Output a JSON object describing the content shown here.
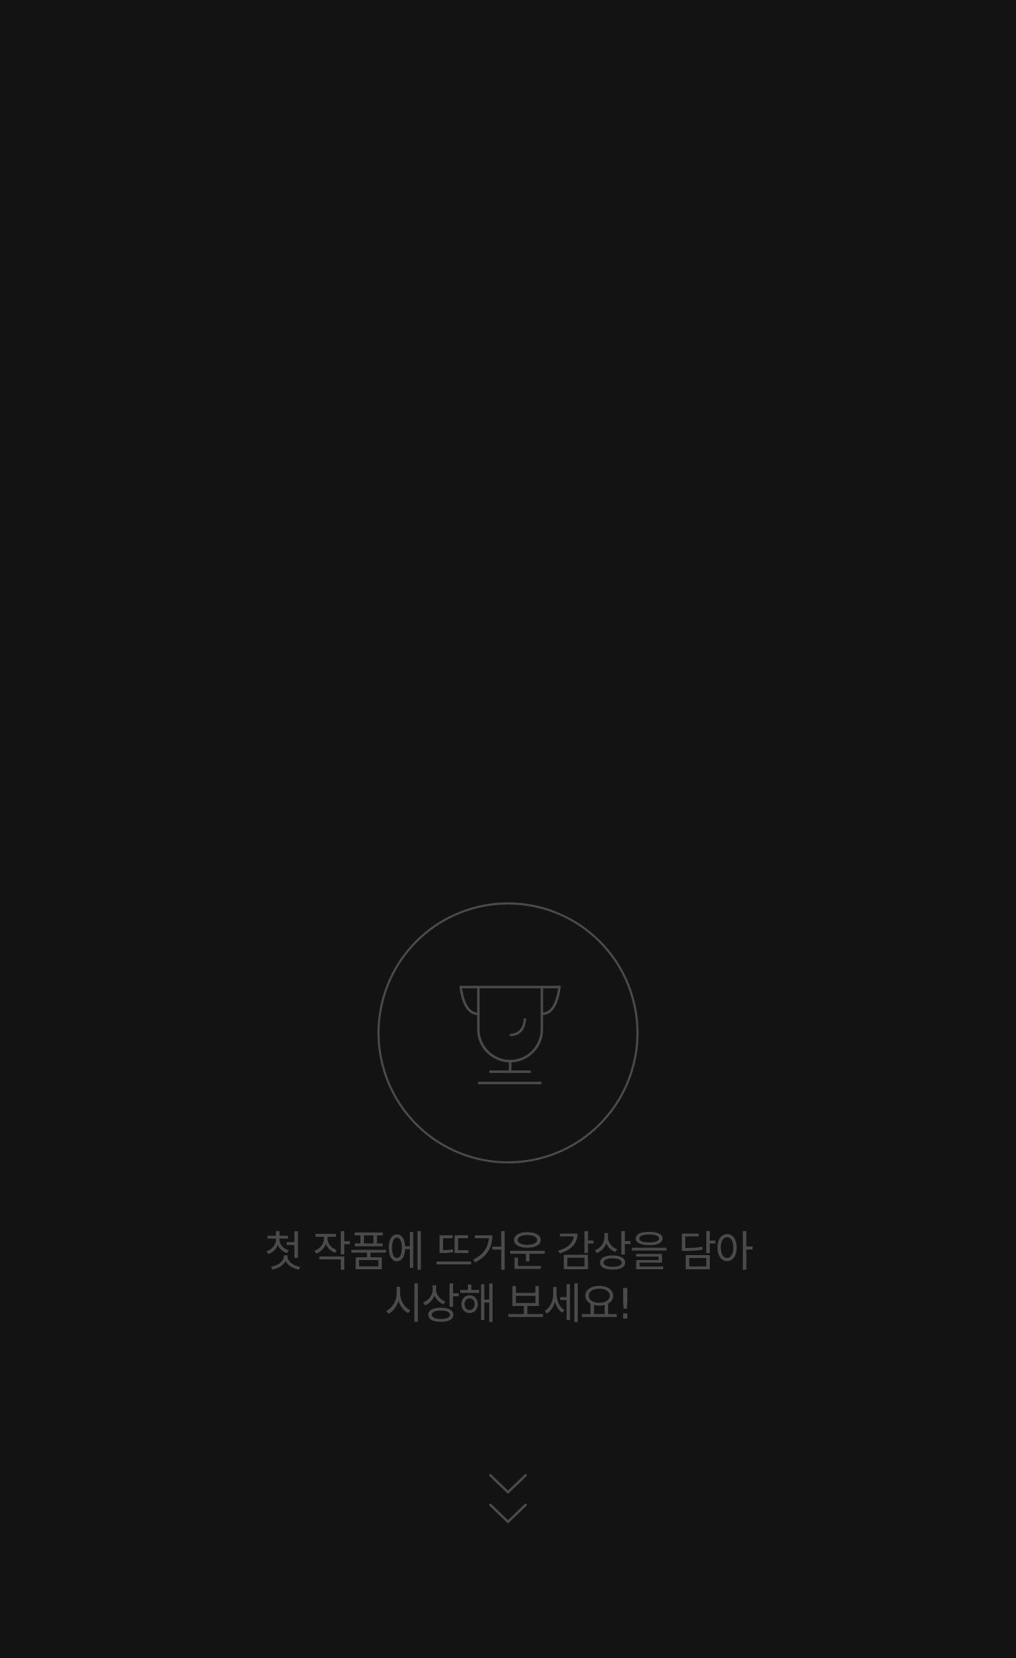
{
  "empty_state": {
    "icon": "trophy-icon",
    "message_line1": "첫 작품에 뜨거운 감상을 담아",
    "message_line2": "시상해 보세요!"
  },
  "scroll_hint": {
    "icon": "double-chevron-down-icon"
  },
  "colors": {
    "background": "#131313",
    "muted": "#4a4a4a"
  }
}
